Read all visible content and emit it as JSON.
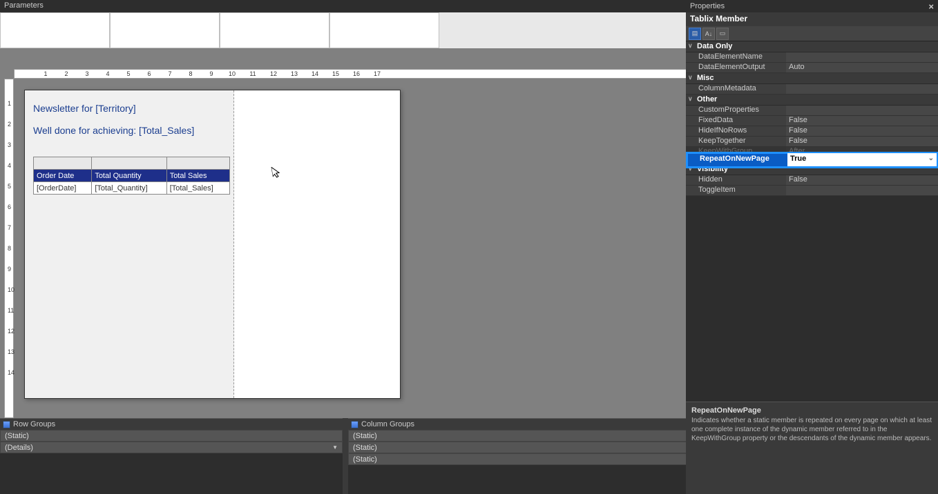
{
  "parameters": {
    "title": "Parameters"
  },
  "ruler_h": [
    1,
    2,
    3,
    4,
    5,
    6,
    7,
    8,
    9,
    10,
    11,
    12,
    13,
    14,
    15,
    16,
    17
  ],
  "ruler_v": [
    1,
    2,
    3,
    4,
    5,
    6,
    7,
    8,
    9,
    10,
    11,
    12,
    13,
    14
  ],
  "report": {
    "text1": "Newsletter for [Territory]",
    "text2": "Well done for achieving: [Total_Sales]",
    "headers": [
      "Order Date",
      "Total Quantity",
      "Total Sales"
    ],
    "cells": [
      "[OrderDate]",
      "[Total_Quantity]",
      "[Total_Sales]"
    ]
  },
  "groups": {
    "rowTitle": "Row Groups",
    "colTitle": "Column Groups",
    "rowItems": [
      "(Static)",
      "(Details)"
    ],
    "colItems": [
      "(Static)",
      "(Static)",
      "(Static)"
    ]
  },
  "properties": {
    "panelTitle": "Properties",
    "objectTitle": "Tablix Member",
    "categories": [
      {
        "name": "Data Only",
        "rows": [
          {
            "n": "DataElementName",
            "v": ""
          },
          {
            "n": "DataElementOutput",
            "v": "Auto"
          }
        ]
      },
      {
        "name": "Misc",
        "rows": [
          {
            "n": "ColumnMetadata",
            "v": ""
          }
        ]
      },
      {
        "name": "Other",
        "rows": [
          {
            "n": "CustomProperties",
            "v": ""
          },
          {
            "n": "FixedData",
            "v": "False"
          },
          {
            "n": "HideIfNoRows",
            "v": "False"
          },
          {
            "n": "KeepTogether",
            "v": "False"
          },
          {
            "n": "KeepWithGroup",
            "v": "After",
            "hidden": true
          },
          {
            "n": "RepeatOnNewPage",
            "v": "True",
            "hl": true
          }
        ]
      },
      {
        "name": "Visibility",
        "rows": [
          {
            "n": "Hidden",
            "v": "False"
          },
          {
            "n": "ToggleItem",
            "v": ""
          }
        ]
      }
    ],
    "help": {
      "title": "RepeatOnNewPage",
      "text": "Indicates whether a static member is repeated on every page on which at least one complete instance of the dynamic member referred to in the KeepWithGroup property or the descendants of the dynamic member appears."
    }
  }
}
